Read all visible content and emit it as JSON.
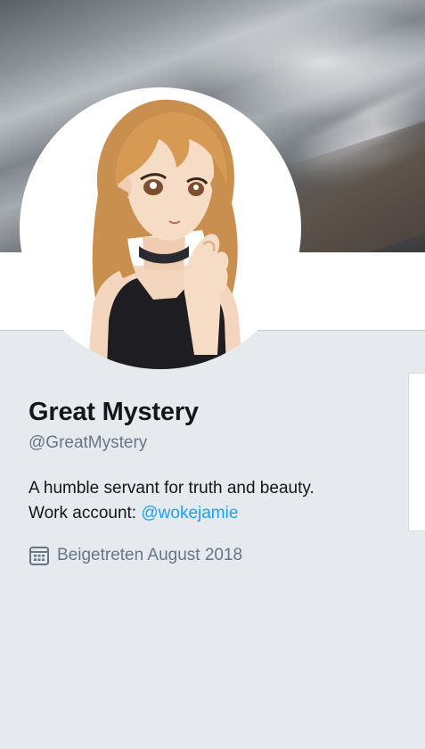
{
  "profile": {
    "display_name": "Great Mystery",
    "handle": "@GreatMystery",
    "bio_line1": "A humble servant for truth and beauty.",
    "bio_line2_prefix": "Work account: ",
    "bio_link": "@wokejamie",
    "joined_text": "Beigetreten August 2018"
  },
  "icons": {
    "calendar": "calendar-icon"
  },
  "colors": {
    "link": "#1da1f2",
    "secondary_text": "#657786",
    "primary_text": "#14171a",
    "background": "#e6e9ee"
  }
}
